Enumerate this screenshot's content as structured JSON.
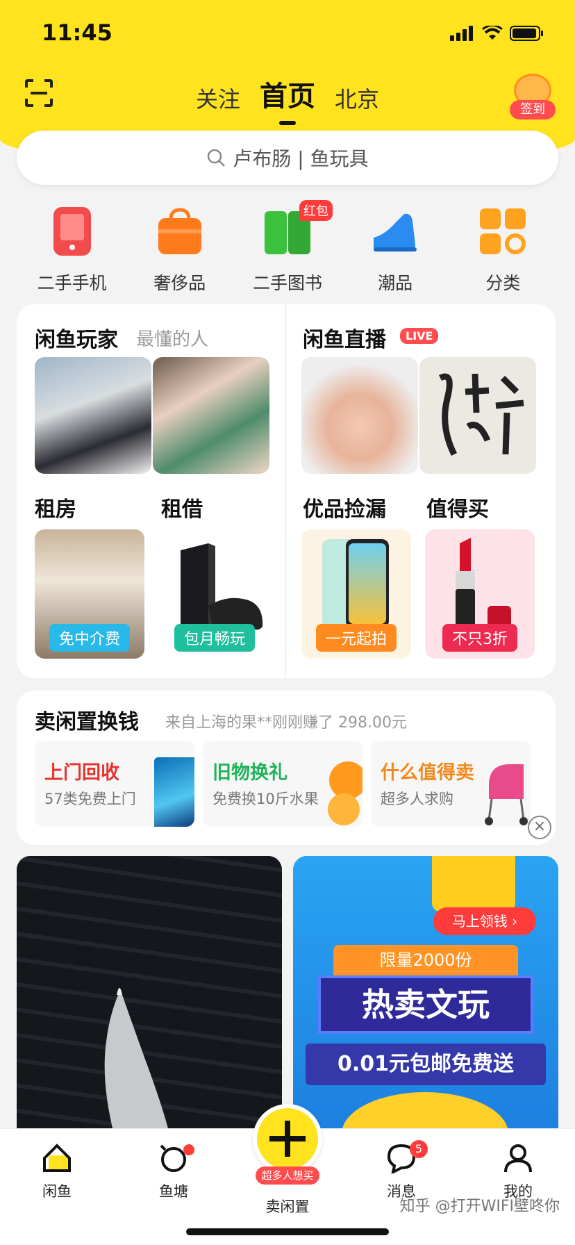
{
  "status_bar": {
    "time": "11:45"
  },
  "header": {
    "tabs": [
      {
        "label": "关注"
      },
      {
        "label": "首页"
      },
      {
        "label": "北京"
      }
    ],
    "signin_label": "签到"
  },
  "search": {
    "placeholder": "卢布肠 | 鱼玩具"
  },
  "categories": [
    {
      "label": "二手手机",
      "icon": "phone-icon",
      "color": "#f24b4b"
    },
    {
      "label": "奢侈品",
      "icon": "bag-icon",
      "color": "#ff7a1a"
    },
    {
      "label": "二手图书",
      "icon": "book-icon",
      "color": "#3cc13c",
      "badge": "红包"
    },
    {
      "label": "潮品",
      "icon": "sneaker-icon",
      "color": "#2a8cf0"
    },
    {
      "label": "分类",
      "icon": "grid-icon",
      "color": "#ffa21f"
    }
  ],
  "sections": {
    "players": {
      "title": "闲鱼玩家",
      "subtitle": "最懂的人"
    },
    "live": {
      "title": "闲鱼直播",
      "badge": "LIVE"
    },
    "rent": {
      "title": "租房",
      "tag": "免中介费"
    },
    "borrow": {
      "title": "租借",
      "tag": "包月畅玩"
    },
    "picks": {
      "title": "优品捡漏",
      "tag": "一元起拍"
    },
    "worth": {
      "title": "值得买",
      "tag": "不只3折"
    }
  },
  "sell": {
    "title": "卖闲置换钱",
    "ticker": "来自上海的果**刚刚赚了 298.00元",
    "items": [
      {
        "title": "上门回收",
        "sub": "57类免费上门",
        "color": "#e5322d"
      },
      {
        "title": "旧物换礼",
        "sub": "免费换10斤水果",
        "color": "#20b35a"
      },
      {
        "title": "什么值得卖",
        "sub": "超多人求购",
        "color": "#f08a1c"
      }
    ]
  },
  "ad": {
    "cta": "马上领钱",
    "limit": "限量2000份",
    "headline": "热卖文玩",
    "offer": "0.01元包邮免费送"
  },
  "tabbar": {
    "items": [
      {
        "label": "闲鱼"
      },
      {
        "label": "鱼塘"
      },
      {
        "label": "卖闲置"
      },
      {
        "label": "消息",
        "badge": "5"
      },
      {
        "label": "我的"
      }
    ],
    "fab_tag": "超多人想买"
  },
  "watermark": "知乎 @打开WIFI壁咚你",
  "colors": {
    "brand_yellow": "#ffe31f",
    "red": "#ff4d4f"
  }
}
